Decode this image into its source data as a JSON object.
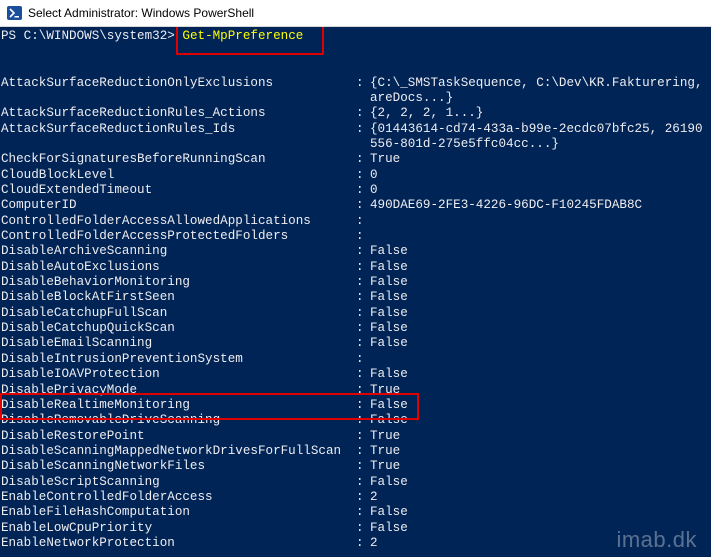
{
  "window": {
    "title": "Select Administrator: Windows PowerShell",
    "icon": "powershell-icon"
  },
  "console": {
    "prompt": "PS C:\\WINDOWS\\system32> ",
    "command": "Get-MpPreference",
    "separator": ":",
    "properties": [
      {
        "name": "AttackSurfaceReductionOnlyExclusions",
        "value": "{C:\\_SMSTaskSequence, C:\\Dev\\KR.Fakturering,",
        "cont": "areDocs...}"
      },
      {
        "name": "AttackSurfaceReductionRules_Actions",
        "value": "{2, 2, 2, 1...}"
      },
      {
        "name": "AttackSurfaceReductionRules_Ids",
        "value": "{01443614-cd74-433a-b99e-2ecdc07bfc25, 26190",
        "cont": "556-801d-275e5ffc04cc...}"
      },
      {
        "name": "CheckForSignaturesBeforeRunningScan",
        "value": "True"
      },
      {
        "name": "CloudBlockLevel",
        "value": "0"
      },
      {
        "name": "CloudExtendedTimeout",
        "value": "0"
      },
      {
        "name": "ComputerID",
        "value": "490DAE69-2FE3-4226-96DC-F10245FDAB8C"
      },
      {
        "name": "ControlledFolderAccessAllowedApplications",
        "value": ""
      },
      {
        "name": "ControlledFolderAccessProtectedFolders",
        "value": ""
      },
      {
        "name": "DisableArchiveScanning",
        "value": "False"
      },
      {
        "name": "DisableAutoExclusions",
        "value": "False"
      },
      {
        "name": "DisableBehaviorMonitoring",
        "value": "False"
      },
      {
        "name": "DisableBlockAtFirstSeen",
        "value": "False"
      },
      {
        "name": "DisableCatchupFullScan",
        "value": "False"
      },
      {
        "name": "DisableCatchupQuickScan",
        "value": "False"
      },
      {
        "name": "DisableEmailScanning",
        "value": "False"
      },
      {
        "name": "DisableIntrusionPreventionSystem",
        "value": ""
      },
      {
        "name": "DisableIOAVProtection",
        "value": "False"
      },
      {
        "name": "DisablePrivacyMode",
        "value": "True"
      },
      {
        "name": "DisableRealtimeMonitoring",
        "value": "False"
      },
      {
        "name": "DisableRemovableDriveScanning",
        "value": "False"
      },
      {
        "name": "DisableRestorePoint",
        "value": "True"
      },
      {
        "name": "DisableScanningMappedNetworkDrivesForFullScan",
        "value": "True"
      },
      {
        "name": "DisableScanningNetworkFiles",
        "value": "True"
      },
      {
        "name": "DisableScriptScanning",
        "value": "False"
      },
      {
        "name": "EnableControlledFolderAccess",
        "value": "2"
      },
      {
        "name": "EnableFileHashComputation",
        "value": "False"
      },
      {
        "name": "EnableLowCpuPriority",
        "value": "False"
      },
      {
        "name": "EnableNetworkProtection",
        "value": "2"
      }
    ]
  },
  "watermark": "imab.dk",
  "colors": {
    "background": "#012456",
    "text": "#eeedf0",
    "command": "#ffff00",
    "annotation": "#e00000"
  }
}
